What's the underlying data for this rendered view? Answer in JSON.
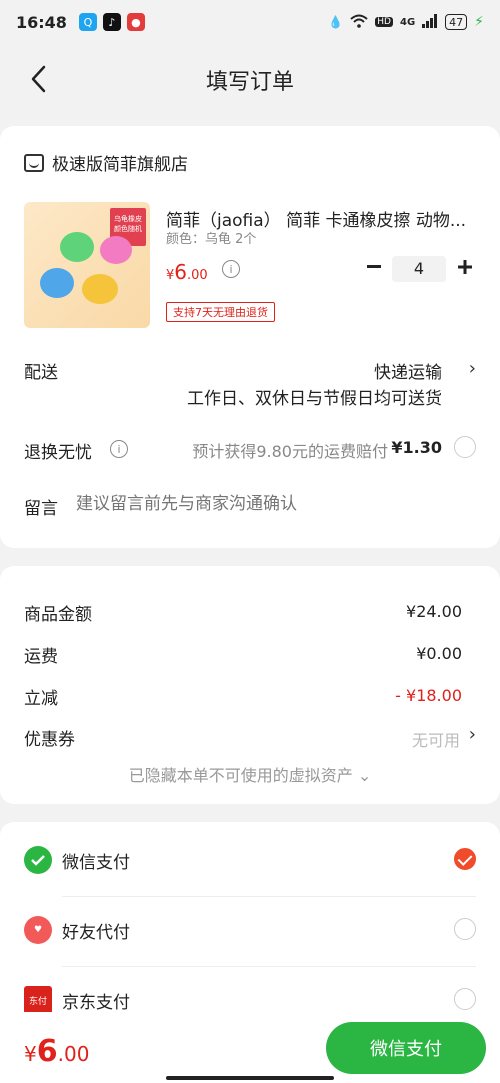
{
  "status_bar": {
    "time": "16:48",
    "network": "4G",
    "hd": "HD",
    "battery": "47"
  },
  "nav": {
    "title": "填写订单"
  },
  "shop": {
    "name": "极速版简菲旗舰店"
  },
  "product": {
    "title": "简菲（jaofia） 简菲 卡通橡皮擦 动物...",
    "variant": "颜色：乌龟 2个",
    "price_symbol": "¥",
    "price_int": "6",
    "price_dec": ".00",
    "image_tag": "乌龟橡皮 颜色随机",
    "quantity": "4",
    "return_badge": "支持7天无理由退货"
  },
  "delivery": {
    "label": "配送",
    "method": "快递运输",
    "note": "工作日、双休日与节假日均可送货"
  },
  "insurance": {
    "label": "退换无忧",
    "text": "预计获得9.80元的运费赔付",
    "price": "¥1.30"
  },
  "remark": {
    "label": "留言",
    "placeholder": "建议留言前先与商家沟通确认"
  },
  "summary": {
    "goods_label": "商品金额",
    "goods_value": "¥24.00",
    "shipping_label": "运费",
    "shipping_value": "¥0.00",
    "discount_label": "立减",
    "discount_value": "- ¥18.00",
    "coupon_label": "优惠券",
    "coupon_value": "无可用",
    "hidden_assets": "已隐藏本单不可使用的虚拟资产 ⌄"
  },
  "payment": {
    "methods": [
      {
        "label": "微信支付",
        "selected": true
      },
      {
        "label": "好友代付",
        "selected": false
      },
      {
        "label": "京东支付",
        "selected": false
      }
    ],
    "jd_icon_text": "东付"
  },
  "bottom": {
    "symbol": "¥",
    "total_int": "6",
    "total_dec": ".00",
    "pay_button": "微信支付"
  },
  "colors": {
    "accent_red": "#e0221b",
    "wechat_green": "#2bb644",
    "check_orange": "#f04b2b"
  }
}
